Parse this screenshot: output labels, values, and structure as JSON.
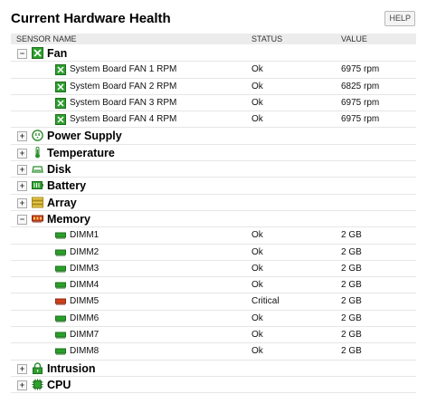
{
  "header": {
    "title": "Current Hardware Health",
    "help_label": "HELP"
  },
  "columns": {
    "name": "SENSOR NAME",
    "status": "STATUS",
    "value": "VALUE"
  },
  "toggles": {
    "expanded": "−",
    "collapsed": "+"
  },
  "groups": {
    "fan": {
      "label": "Fan",
      "icon": "fan-icon",
      "expanded": true,
      "items": [
        {
          "name": "System Board FAN 1 RPM",
          "status": "Ok",
          "value": "6975 rpm"
        },
        {
          "name": "System Board FAN 2 RPM",
          "status": "Ok",
          "value": "6825 rpm"
        },
        {
          "name": "System Board FAN 3 RPM",
          "status": "Ok",
          "value": "6975 rpm"
        },
        {
          "name": "System Board FAN 4 RPM",
          "status": "Ok",
          "value": "6975 rpm"
        }
      ]
    },
    "power_supply": {
      "label": "Power Supply",
      "icon": "power-plug-icon",
      "expanded": false
    },
    "temperature": {
      "label": "Temperature",
      "icon": "thermometer-icon",
      "expanded": false
    },
    "disk": {
      "label": "Disk",
      "icon": "disk-icon",
      "expanded": false
    },
    "battery": {
      "label": "Battery",
      "icon": "battery-icon",
      "expanded": false
    },
    "array": {
      "label": "Array",
      "icon": "array-icon",
      "expanded": false
    },
    "memory": {
      "label": "Memory",
      "icon": "memory-icon",
      "expanded": true,
      "items": [
        {
          "name": "DIMM1",
          "status": "Ok",
          "value": "2 GB",
          "color": "#2aa02a"
        },
        {
          "name": "DIMM2",
          "status": "Ok",
          "value": "2 GB",
          "color": "#2aa02a"
        },
        {
          "name": "DIMM3",
          "status": "Ok",
          "value": "2 GB",
          "color": "#2aa02a"
        },
        {
          "name": "DIMM4",
          "status": "Ok",
          "value": "2 GB",
          "color": "#2aa02a"
        },
        {
          "name": "DIMM5",
          "status": "Critical",
          "value": "2 GB",
          "color": "#d0401a"
        },
        {
          "name": "DIMM6",
          "status": "Ok",
          "value": "2 GB",
          "color": "#2aa02a"
        },
        {
          "name": "DIMM7",
          "status": "Ok",
          "value": "2 GB",
          "color": "#2aa02a"
        },
        {
          "name": "DIMM8",
          "status": "Ok",
          "value": "2 GB",
          "color": "#2aa02a"
        }
      ]
    },
    "intrusion": {
      "label": "Intrusion",
      "icon": "lock-icon",
      "expanded": false
    },
    "cpu": {
      "label": "CPU",
      "icon": "cpu-icon",
      "expanded": false
    }
  }
}
